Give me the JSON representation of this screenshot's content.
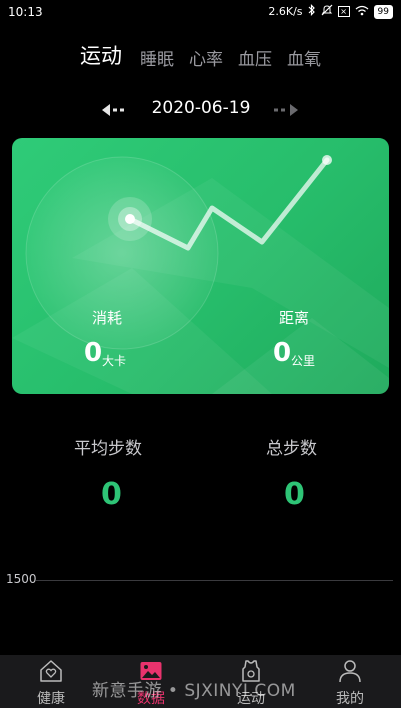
{
  "status_bar": {
    "time": "10:13",
    "network_speed": "2.6K/s",
    "battery": "99",
    "icons": [
      "bluetooth-icon",
      "mute-icon",
      "sim-icon",
      "wifi-icon",
      "battery-icon"
    ]
  },
  "tabs": [
    {
      "label": "运动",
      "active": true
    },
    {
      "label": "睡眠",
      "active": false
    },
    {
      "label": "心率",
      "active": false
    },
    {
      "label": "血压",
      "active": false
    },
    {
      "label": "血氧",
      "active": false
    }
  ],
  "date": "2020-06-19",
  "card": {
    "consumption": {
      "label": "消耗",
      "value": "0",
      "unit": "大卡"
    },
    "distance": {
      "label": "距离",
      "value": "0",
      "unit": "公里"
    }
  },
  "stats": {
    "avg_steps": {
      "label": "平均步数",
      "value": "0"
    },
    "total_steps": {
      "label": "总步数",
      "value": "0"
    }
  },
  "chart": {
    "axis_label": "1500"
  },
  "bottom_nav": [
    {
      "label": "健康",
      "icon": "heart-house-icon",
      "active": false
    },
    {
      "label": "数据",
      "icon": "data-image-icon",
      "active": true
    },
    {
      "label": "运动",
      "icon": "sport-shirt-icon",
      "active": false
    },
    {
      "label": "我的",
      "icon": "person-icon",
      "active": false
    }
  ],
  "watermark": "新意手游 • SJXINYI.COM",
  "colors": {
    "accent_green": "#2ec476",
    "active_nav": "#e8336d",
    "background": "#000000"
  }
}
